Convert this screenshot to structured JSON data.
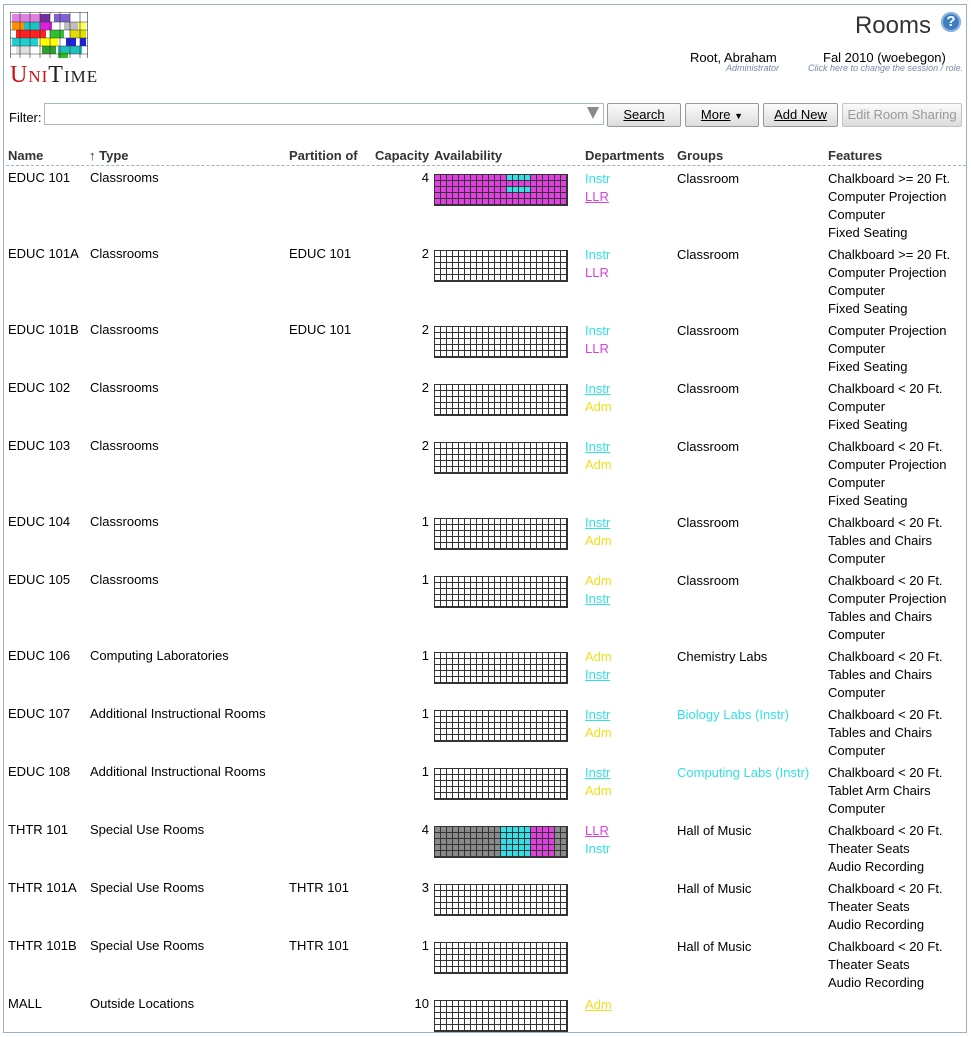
{
  "header": {
    "logo_text": "UniTime",
    "page_title": "Rooms",
    "help_icon": "question-mark-icon",
    "user": {
      "name": "Root, Abraham",
      "role": "Administrator"
    },
    "session": {
      "name": "Fal 2010 (woebegon)",
      "hint": "Click here to change the session / role."
    }
  },
  "filter": {
    "label": "Filter:",
    "value": "",
    "buttons": {
      "search": "Search",
      "more": "More",
      "add_new": "Add New",
      "edit_room_sharing": "Edit Room Sharing"
    }
  },
  "colors": {
    "instr": "#33e0e8",
    "llr": "#e040e0",
    "adm": "#f0e020",
    "gray": "#8a8a8a"
  },
  "table": {
    "columns": {
      "name": "Name",
      "type": "Type",
      "type_sort": "↑",
      "partition": "Partition of",
      "capacity": "Capacity",
      "availability": "Availability",
      "departments": "Departments",
      "groups": "Groups",
      "features": "Features"
    },
    "rows": [
      {
        "name": "EDUC 101",
        "type": "Classrooms",
        "partition": "",
        "capacity": "4",
        "avail": "llr-with-instr",
        "departments": [
          {
            "code": "Instr",
            "color": "instr",
            "link": false
          },
          {
            "code": "LLR",
            "color": "llr",
            "link": true
          }
        ],
        "groups": [
          {
            "label": "Classroom",
            "color": ""
          }
        ],
        "features": [
          "Chalkboard >= 20 Ft.",
          "Computer Projection",
          "Computer",
          "Fixed Seating"
        ]
      },
      {
        "name": "EDUC 101A",
        "type": "Classrooms",
        "partition": "EDUC 101",
        "capacity": "2",
        "avail": "empty",
        "departments": [
          {
            "code": "Instr",
            "color": "instr",
            "link": false
          },
          {
            "code": "LLR",
            "color": "llr",
            "link": false
          }
        ],
        "groups": [
          {
            "label": "Classroom",
            "color": ""
          }
        ],
        "features": [
          "Chalkboard >= 20 Ft.",
          "Computer Projection",
          "Computer",
          "Fixed Seating"
        ]
      },
      {
        "name": "EDUC 101B",
        "type": "Classrooms",
        "partition": "EDUC 101",
        "capacity": "2",
        "avail": "empty",
        "departments": [
          {
            "code": "Instr",
            "color": "instr",
            "link": false
          },
          {
            "code": "LLR",
            "color": "llr",
            "link": false
          }
        ],
        "groups": [
          {
            "label": "Classroom",
            "color": ""
          }
        ],
        "features": [
          "Computer Projection",
          "Computer",
          "Fixed Seating"
        ]
      },
      {
        "name": "EDUC 102",
        "type": "Classrooms",
        "partition": "",
        "capacity": "2",
        "avail": "empty",
        "departments": [
          {
            "code": "Instr",
            "color": "instr",
            "link": true
          },
          {
            "code": "Adm",
            "color": "adm",
            "link": false
          }
        ],
        "groups": [
          {
            "label": "Classroom",
            "color": ""
          }
        ],
        "features": [
          "Chalkboard < 20 Ft.",
          "Computer",
          "Fixed Seating"
        ]
      },
      {
        "name": "EDUC 103",
        "type": "Classrooms",
        "partition": "",
        "capacity": "2",
        "avail": "empty",
        "departments": [
          {
            "code": "Instr",
            "color": "instr",
            "link": true
          },
          {
            "code": "Adm",
            "color": "adm",
            "link": false
          }
        ],
        "groups": [
          {
            "label": "Classroom",
            "color": ""
          }
        ],
        "features": [
          "Chalkboard < 20 Ft.",
          "Computer Projection",
          "Computer",
          "Fixed Seating"
        ]
      },
      {
        "name": "EDUC 104",
        "type": "Classrooms",
        "partition": "",
        "capacity": "1",
        "avail": "empty",
        "departments": [
          {
            "code": "Instr",
            "color": "instr",
            "link": true
          },
          {
            "code": "Adm",
            "color": "adm",
            "link": false
          }
        ],
        "groups": [
          {
            "label": "Classroom",
            "color": ""
          }
        ],
        "features": [
          "Chalkboard < 20 Ft.",
          "Tables and Chairs",
          "Computer"
        ]
      },
      {
        "name": "EDUC 105",
        "type": "Classrooms",
        "partition": "",
        "capacity": "1",
        "avail": "empty",
        "departments": [
          {
            "code": "Adm",
            "color": "adm",
            "link": false
          },
          {
            "code": "Instr",
            "color": "instr",
            "link": true
          }
        ],
        "groups": [
          {
            "label": "Classroom",
            "color": ""
          }
        ],
        "features": [
          "Chalkboard < 20 Ft.",
          "Computer Projection",
          "Tables and Chairs",
          "Computer"
        ]
      },
      {
        "name": "EDUC 106",
        "type": "Computing Laboratories",
        "partition": "",
        "capacity": "1",
        "avail": "empty",
        "departments": [
          {
            "code": "Adm",
            "color": "adm",
            "link": false
          },
          {
            "code": "Instr",
            "color": "instr",
            "link": true
          }
        ],
        "groups": [
          {
            "label": "Chemistry Labs",
            "color": ""
          }
        ],
        "features": [
          "Chalkboard < 20 Ft.",
          "Tables and Chairs",
          "Computer"
        ]
      },
      {
        "name": "EDUC 107",
        "type": "Additional Instructional Rooms",
        "partition": "",
        "capacity": "1",
        "avail": "empty",
        "departments": [
          {
            "code": "Instr",
            "color": "instr",
            "link": true
          },
          {
            "code": "Adm",
            "color": "adm",
            "link": false
          }
        ],
        "groups": [
          {
            "label": "Biology Labs (Instr)",
            "color": "instr"
          }
        ],
        "features": [
          "Chalkboard < 20 Ft.",
          "Tables and Chairs",
          "Computer"
        ]
      },
      {
        "name": "EDUC 108",
        "type": "Additional Instructional Rooms",
        "partition": "",
        "capacity": "1",
        "avail": "empty",
        "departments": [
          {
            "code": "Instr",
            "color": "instr",
            "link": true
          },
          {
            "code": "Adm",
            "color": "adm",
            "link": false
          }
        ],
        "groups": [
          {
            "label": "Computing Labs (Instr)",
            "color": "instr"
          }
        ],
        "features": [
          "Chalkboard < 20 Ft.",
          "Tablet Arm Chairs",
          "Computer"
        ]
      },
      {
        "name": "THTR 101",
        "type": "Special Use Rooms",
        "partition": "",
        "capacity": "4",
        "avail": "thtr",
        "departments": [
          {
            "code": "LLR",
            "color": "llr",
            "link": true
          },
          {
            "code": "Instr",
            "color": "instr",
            "link": false
          }
        ],
        "groups": [
          {
            "label": "Hall of Music",
            "color": ""
          }
        ],
        "features": [
          "Chalkboard < 20 Ft.",
          "Theater Seats",
          "Audio Recording"
        ]
      },
      {
        "name": "THTR 101A",
        "type": "Special Use Rooms",
        "partition": "THTR 101",
        "capacity": "3",
        "avail": "empty",
        "departments": [],
        "groups": [
          {
            "label": "Hall of Music",
            "color": ""
          }
        ],
        "features": [
          "Chalkboard < 20 Ft.",
          "Theater Seats",
          "Audio Recording"
        ]
      },
      {
        "name": "THTR 101B",
        "type": "Special Use Rooms",
        "partition": "THTR 101",
        "capacity": "1",
        "avail": "empty",
        "departments": [],
        "groups": [
          {
            "label": "Hall of Music",
            "color": ""
          }
        ],
        "features": [
          "Chalkboard < 20 Ft.",
          "Theater Seats",
          "Audio Recording"
        ]
      },
      {
        "name": "MALL",
        "type": "Outside Locations",
        "partition": "",
        "capacity": "10",
        "avail": "empty",
        "departments": [
          {
            "code": "Adm",
            "color": "adm",
            "link": true
          }
        ],
        "groups": [],
        "features": []
      }
    ]
  }
}
